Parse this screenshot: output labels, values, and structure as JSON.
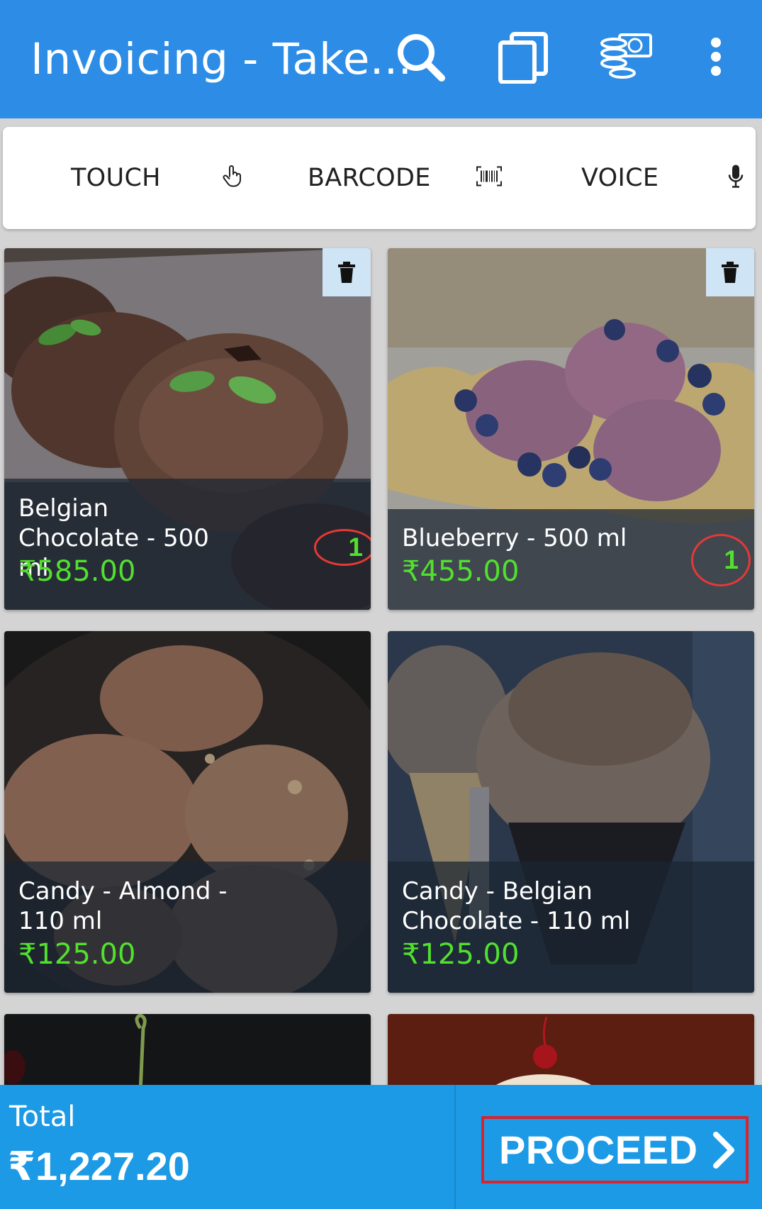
{
  "app_bar": {
    "title": "Invoicing - Take...",
    "background": "#2c8ce6",
    "icons": [
      "search-icon",
      "copy-icon",
      "cash-coins-icon",
      "more-vert-icon"
    ]
  },
  "input_modes": [
    {
      "label": "TOUCH",
      "icon": "touch-hand-icon"
    },
    {
      "label": "BARCODE",
      "icon": "barcode-icon"
    },
    {
      "label": "VOICE",
      "icon": "mic-icon"
    }
  ],
  "products": [
    {
      "name": "Belgian Chocolate - 500 ml",
      "price": "₹585.00",
      "qty": "1"
    },
    {
      "name": "Blueberry - 500 ml",
      "price": "₹455.00",
      "qty": "1"
    },
    {
      "name": "Candy - Almond - 110 ml",
      "price": "₹125.00"
    },
    {
      "name": "Candy - Belgian Chocolate - 110 ml",
      "price": "₹125.00"
    }
  ],
  "footer": {
    "total_label": "Total",
    "total_value": "₹1,227.20",
    "proceed_label": "PROCEED",
    "background": "#1c9ae6",
    "price_color": "#52e02f",
    "highlight_color": "#d9232d"
  }
}
